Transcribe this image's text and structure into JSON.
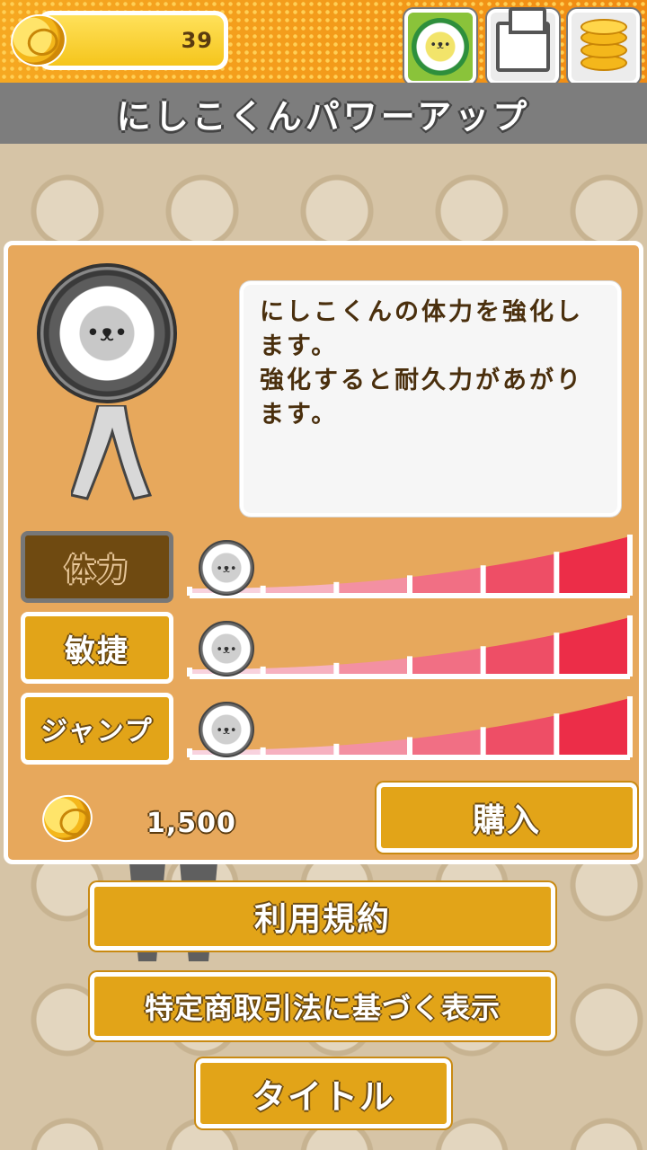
{
  "header": {
    "coin_count": "39",
    "title": "にしこくんパワーアップ",
    "tabs": [
      {
        "icon": "character-icon",
        "active": true
      },
      {
        "icon": "item-box-icon",
        "active": false
      },
      {
        "icon": "coin-shop-icon",
        "active": false
      }
    ]
  },
  "panel": {
    "description": "にしこくんの体力を強化します。\n強化すると耐久力があがります。",
    "stats": [
      {
        "label": "体力",
        "selected": true,
        "level": 1,
        "max_level": 6
      },
      {
        "label": "敏捷",
        "selected": false,
        "level": 1,
        "max_level": 6
      },
      {
        "label": "ジャンプ",
        "selected": false,
        "level": 1,
        "max_level": 6
      }
    ],
    "price": "1,500",
    "buy_label": "購入"
  },
  "buttons": {
    "terms": "利用規約",
    "commerce_law": "特定商取引法に基づく表示",
    "title": "タイトル"
  },
  "colors": {
    "accent": "#e2a418",
    "panel": "#e7a85c",
    "top_bar": "#f39a1a"
  }
}
